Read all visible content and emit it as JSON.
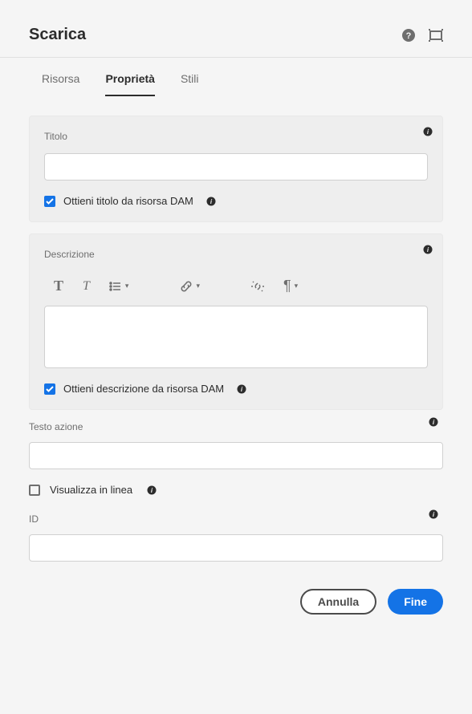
{
  "header": {
    "title": "Scarica"
  },
  "tabs": [
    {
      "label": "Risorsa",
      "active": false
    },
    {
      "label": "Proprietà",
      "active": true
    },
    {
      "label": "Stili",
      "active": false
    }
  ],
  "sections": {
    "titolo": {
      "label": "Titolo",
      "value": "",
      "checkbox_label": "Ottieni titolo da risorsa DAM",
      "checkbox_checked": true
    },
    "descrizione": {
      "label": "Descrizione",
      "value": "",
      "checkbox_label": "Ottieni descrizione da risorsa DAM",
      "checkbox_checked": true
    }
  },
  "fields": {
    "testo_azione": {
      "label": "Testo azione",
      "value": ""
    },
    "visualizza_in_linea": {
      "label": "Visualizza in linea",
      "checked": false
    },
    "id": {
      "label": "ID",
      "value": ""
    }
  },
  "footer": {
    "cancel": "Annulla",
    "done": "Fine"
  }
}
